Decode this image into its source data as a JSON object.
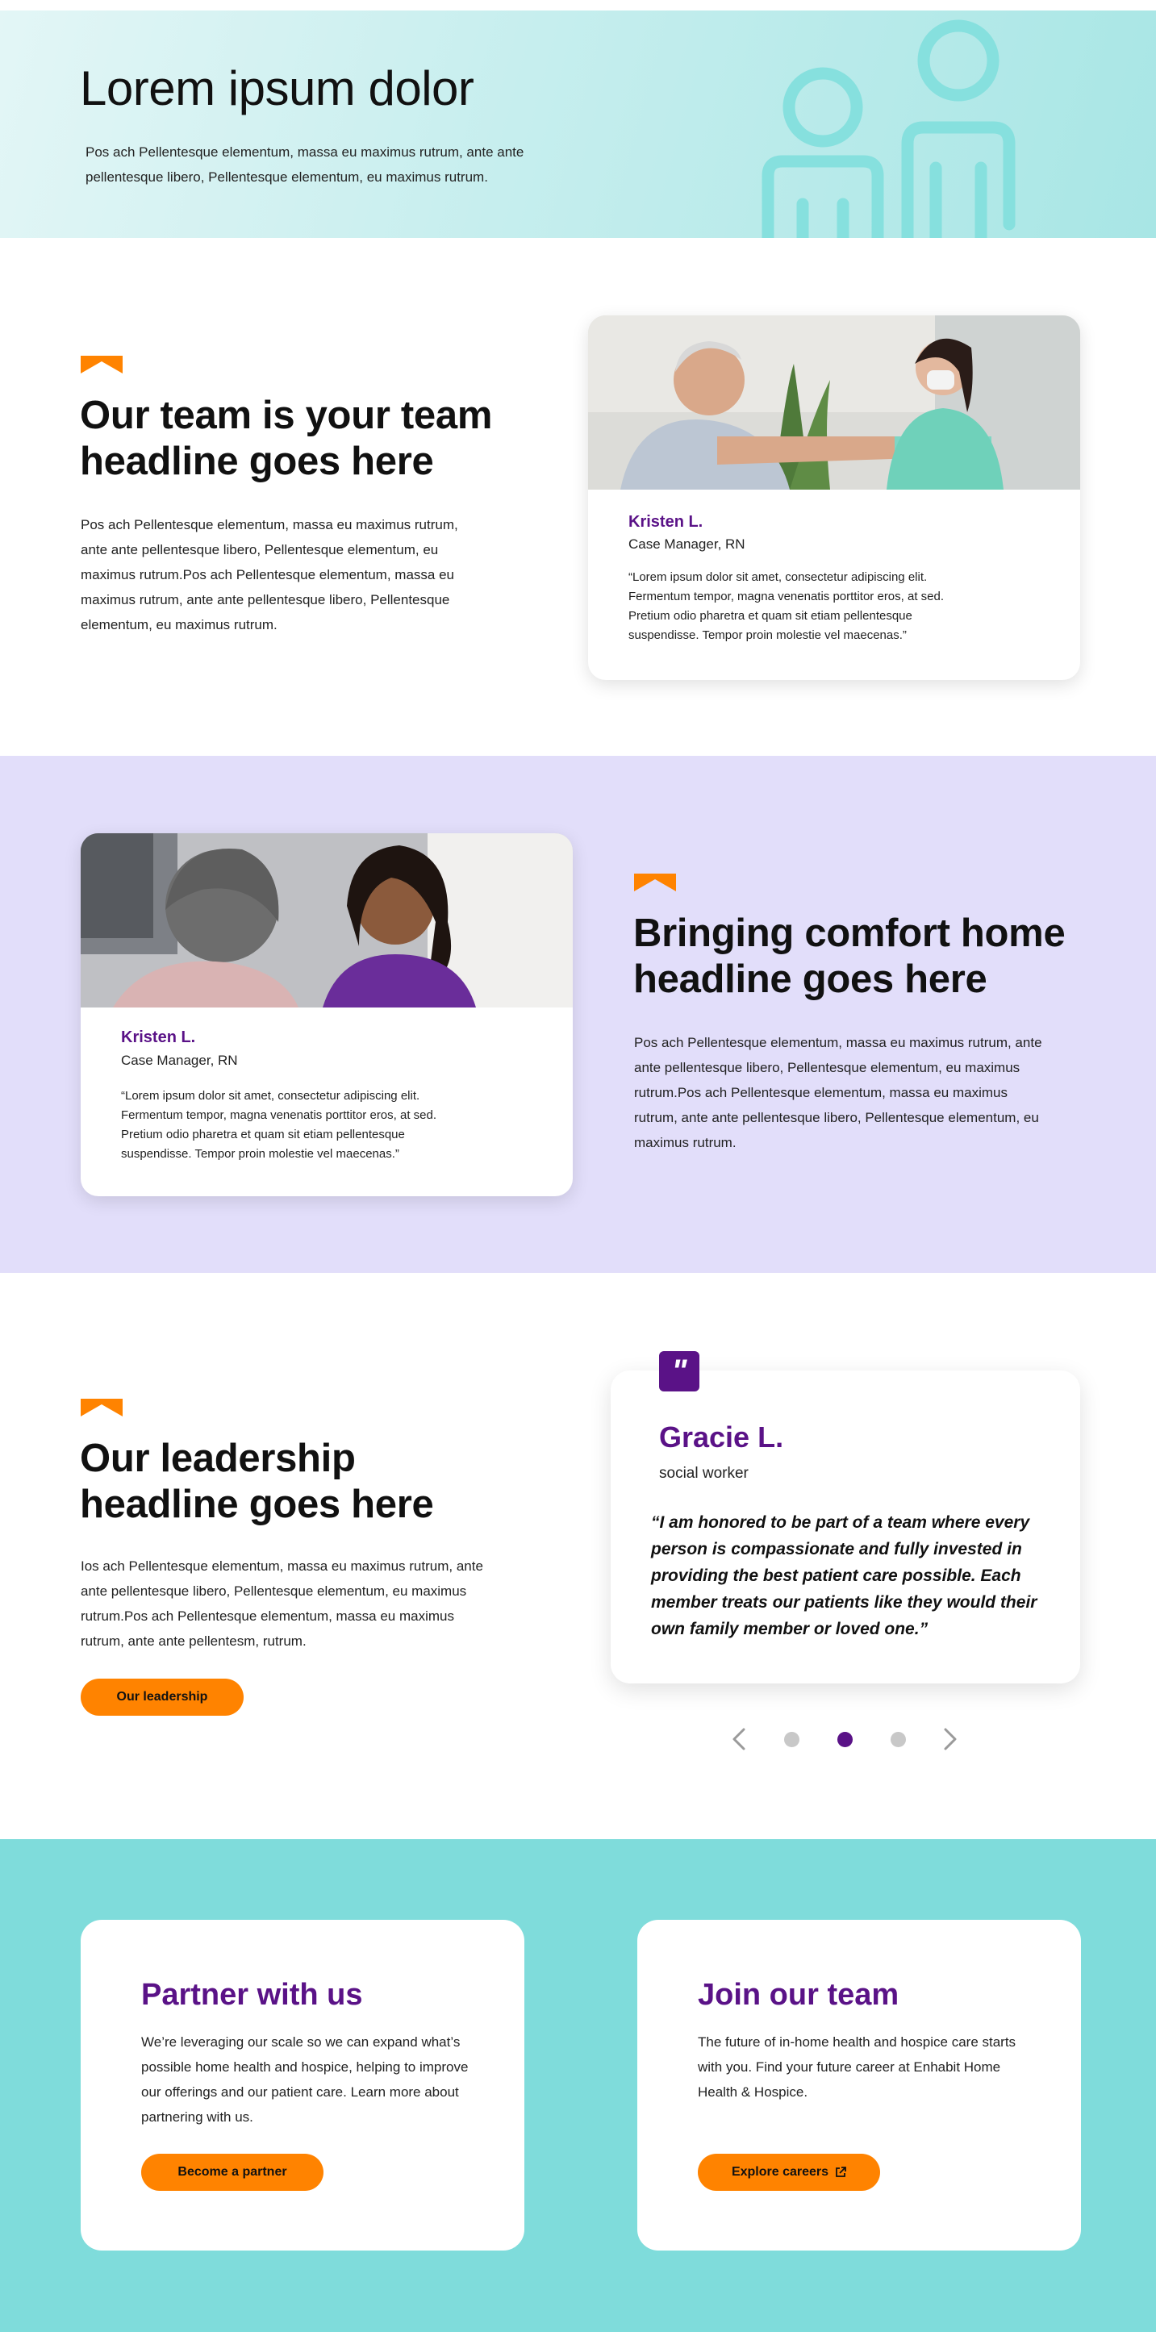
{
  "hero": {
    "title": "Lorem ipsum dolor",
    "text": "Pos ach Pellentesque elementum, massa eu maximus rutrum, ante ante pellentesque libero, Pellentesque elementum,  eu maximus rutrum."
  },
  "team": {
    "headline": "Our team is your team headline goes here",
    "text": "Pos ach Pellentesque elementum, massa eu maximus rutrum, ante ante pellentesque libero, Pellentesque elementum,  eu maximus rutrum.Pos ach Pellentesque elementum, massa eu maximus rutrum, ante ante pellentesque libero, Pellentesque elementum,  eu maximus rutrum.",
    "card": {
      "name": "Kristen L.",
      "role": "Case Manager, RN",
      "quote": "“Lorem ipsum dolor sit amet, consectetur adipiscing elit. Fermentum tempor, magna venenatis porttitor eros, at sed. Pretium odio pharetra et quam sit etiam pellentesque suspendisse. Tempor proin molestie vel maecenas.”"
    }
  },
  "comfort": {
    "headline": "Bringing comfort home headline goes here",
    "text": "Pos ach Pellentesque elementum, massa eu maximus rutrum, ante ante pellentesque libero, Pellentesque elementum,  eu maximus rutrum.Pos ach Pellentesque elementum, massa eu maximus rutrum, ante ante pellentesque libero, Pellentesque elementum,  eu maximus rutrum.",
    "card": {
      "name": "Kristen L.",
      "role": "Case Manager, RN",
      "quote": "“Lorem ipsum dolor sit amet, consectetur adipiscing elit. Fermentum tempor, magna venenatis porttitor eros, at sed. Pretium odio pharetra et quam sit etiam pellentesque suspendisse. Tempor proin molestie vel maecenas.”"
    }
  },
  "leadership": {
    "headline": "Our leadership headline goes here",
    "text": "Ios ach Pellentesque elementum, massa eu maximus rutrum, ante ante pellentesque libero, Pellentesque elementum,  eu maximus rutrum.Pos ach Pellentesque elementum, massa eu maximus rutrum, ante ante pellentesm, rutrum.",
    "button_label": "Our leadership",
    "testimonial": {
      "quote_mark": "\"",
      "name": "Gracie L.",
      "role": "social worker",
      "quote": "“I am honored to be part of a team where every person is compassionate and fully invested in providing the best patient care possible. Each member treats our patients like they would their own family member or loved one.”"
    },
    "carousel": {
      "slides": 3,
      "active_index": 1
    }
  },
  "partner": {
    "title": "Partner with us",
    "text": "We’re leveraging our scale so we can expand what’s possible home health and hospice, helping to improve our offerings and our patient care. Learn more about partnering with us.",
    "button_label": "Become a partner"
  },
  "join": {
    "title": "Join our team",
    "text": "The future of in-home health and hospice care starts with you. Find your future career at Enhabit Home Health & Hospice.",
    "button_label": "Explore careers"
  },
  "colors": {
    "accent_orange": "#ff8300",
    "brand_purple": "#5a1287",
    "teal": "#7fdcdb",
    "lavender": "#e2defa"
  },
  "icons": [
    "people-icon",
    "chevron-accent-icon",
    "quote-icon",
    "arrow-left-icon",
    "arrow-right-icon",
    "external-link-icon"
  ]
}
